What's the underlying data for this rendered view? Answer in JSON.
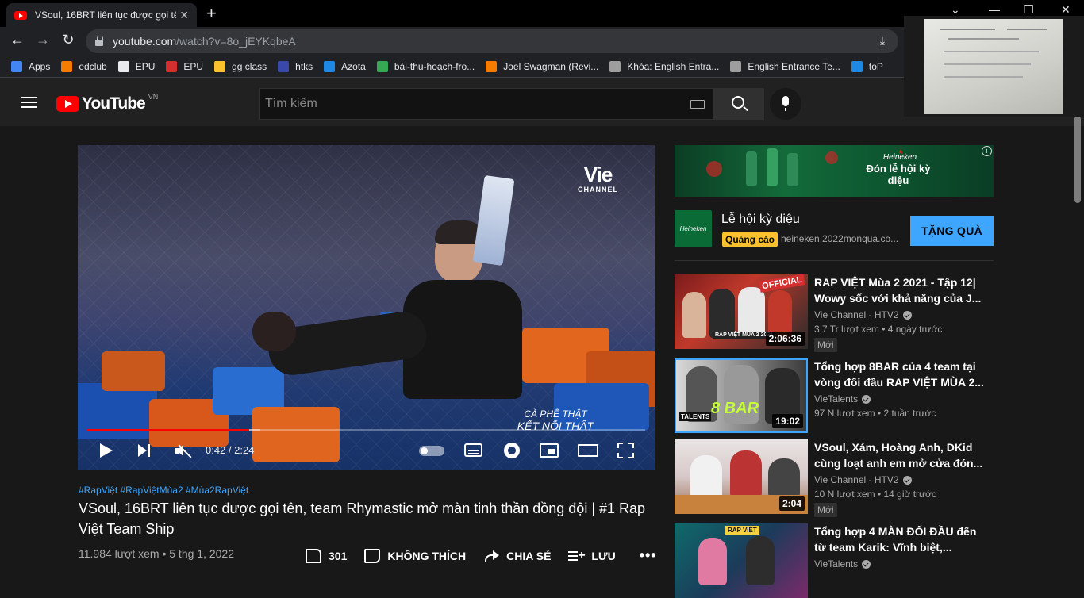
{
  "browser": {
    "tab_title": "VSoul, 16BRT liên tục được gọi tên",
    "tab_close": "✕",
    "new_tab": "+",
    "url_host": "youtube.com",
    "url_path": "/watch?v=8o_jEYKqbeA",
    "window_controls": {
      "minimize": "—",
      "maximize": "❐",
      "close": "✕"
    },
    "bookmarks": [
      {
        "label": "Apps",
        "color": "#4285f4"
      },
      {
        "label": "edclub",
        "color": "#f57c00"
      },
      {
        "label": "EPU",
        "color": "#e8eaed"
      },
      {
        "label": "EPU",
        "color": "#d32f2f"
      },
      {
        "label": "gg class",
        "color": "#fbc02d"
      },
      {
        "label": "htks",
        "color": "#3949ab"
      },
      {
        "label": "Azota",
        "color": "#1e88e5"
      },
      {
        "label": "bài-thu-hoạch-fro...",
        "color": "#34a853"
      },
      {
        "label": "Joel Swagman (Revi...",
        "color": "#f57c00"
      },
      {
        "label": "Khóa: English Entra...",
        "color": "#9e9e9e"
      },
      {
        "label": "English Entrance Te...",
        "color": "#9e9e9e"
      },
      {
        "label": "toP",
        "color": "#1e88e5"
      }
    ]
  },
  "header": {
    "logo_text": "YouTube",
    "country_code": "VN",
    "search_placeholder": "Tìm kiếm"
  },
  "player": {
    "time": "0:42 / 2:24",
    "progress": 0.29,
    "buffered": 0.31,
    "channel_logo_top": "Vie",
    "channel_logo_bottom": "CHANNEL",
    "watermark_1": "CÀ PHÊ THẬT",
    "watermark_2": "KẾT NỐI THẬT"
  },
  "video": {
    "hashtags": "#RapViệt #RapViệtMùa2 #Mùa2RapViệt",
    "title": "VSoul, 16BRT liên tục được gọi tên, team Rhymastic mở màn tinh thần đồng đội | #1 Rap Việt Team Ship",
    "views": "11.984 lượt xem",
    "date": "5 thg 1, 2022",
    "likes": "301",
    "dislike_label": "KHÔNG THÍCH",
    "share_label": "CHIA SẺ",
    "save_label": "LƯU",
    "more": "•••"
  },
  "ad": {
    "banner_brand": "Heineken",
    "banner_line": "Đón lễ hội kỳ diệu",
    "logo_text": "Heineken",
    "title": "Lễ hội kỳ diệu",
    "badge": "Quảng cáo",
    "domain": "heineken.2022monqua.co...",
    "cta": "TẶNG QUÀ"
  },
  "recommendations": [
    {
      "title": "RAP VIỆT Mùa 2 2021 - Tập 12| Wowy sốc với khả năng của J...",
      "channel": "Vie Channel - HTV2",
      "views": "3,7 Tr lượt xem",
      "age": "4 ngày trước",
      "duration": "2:06:36",
      "badge": "Mới"
    },
    {
      "title": "Tổng hợp 8BAR của 4 team tại vòng đối đầu RAP VIỆT MÙA 2...",
      "channel": "VieTalents",
      "views": "97 N lượt xem",
      "age": "2 tuần trước",
      "duration": "19:02",
      "badge": ""
    },
    {
      "title": "VSoul, Xám, Hoàng Anh, DKid cùng loạt anh em mở cửa đón...",
      "channel": "Vie Channel - HTV2",
      "views": "10 N lượt xem",
      "age": "14 giờ trước",
      "duration": "2:04",
      "badge": "Mới"
    },
    {
      "title": "Tổng hợp 4 MÀN ĐỐI ĐẦU đến từ team Karik: Vĩnh biệt,...",
      "channel": "VieTalents",
      "views": "",
      "age": "",
      "duration": "",
      "badge": ""
    }
  ],
  "thumb_text": {
    "rec1_official": "OFFICIAL",
    "rec1_show": "RAP VIỆT MÙA 2 2021",
    "rec2_bar": "8 BAR",
    "rec2_talents": "TALENTS",
    "rec4_playlist": "RAP VIỆT"
  }
}
